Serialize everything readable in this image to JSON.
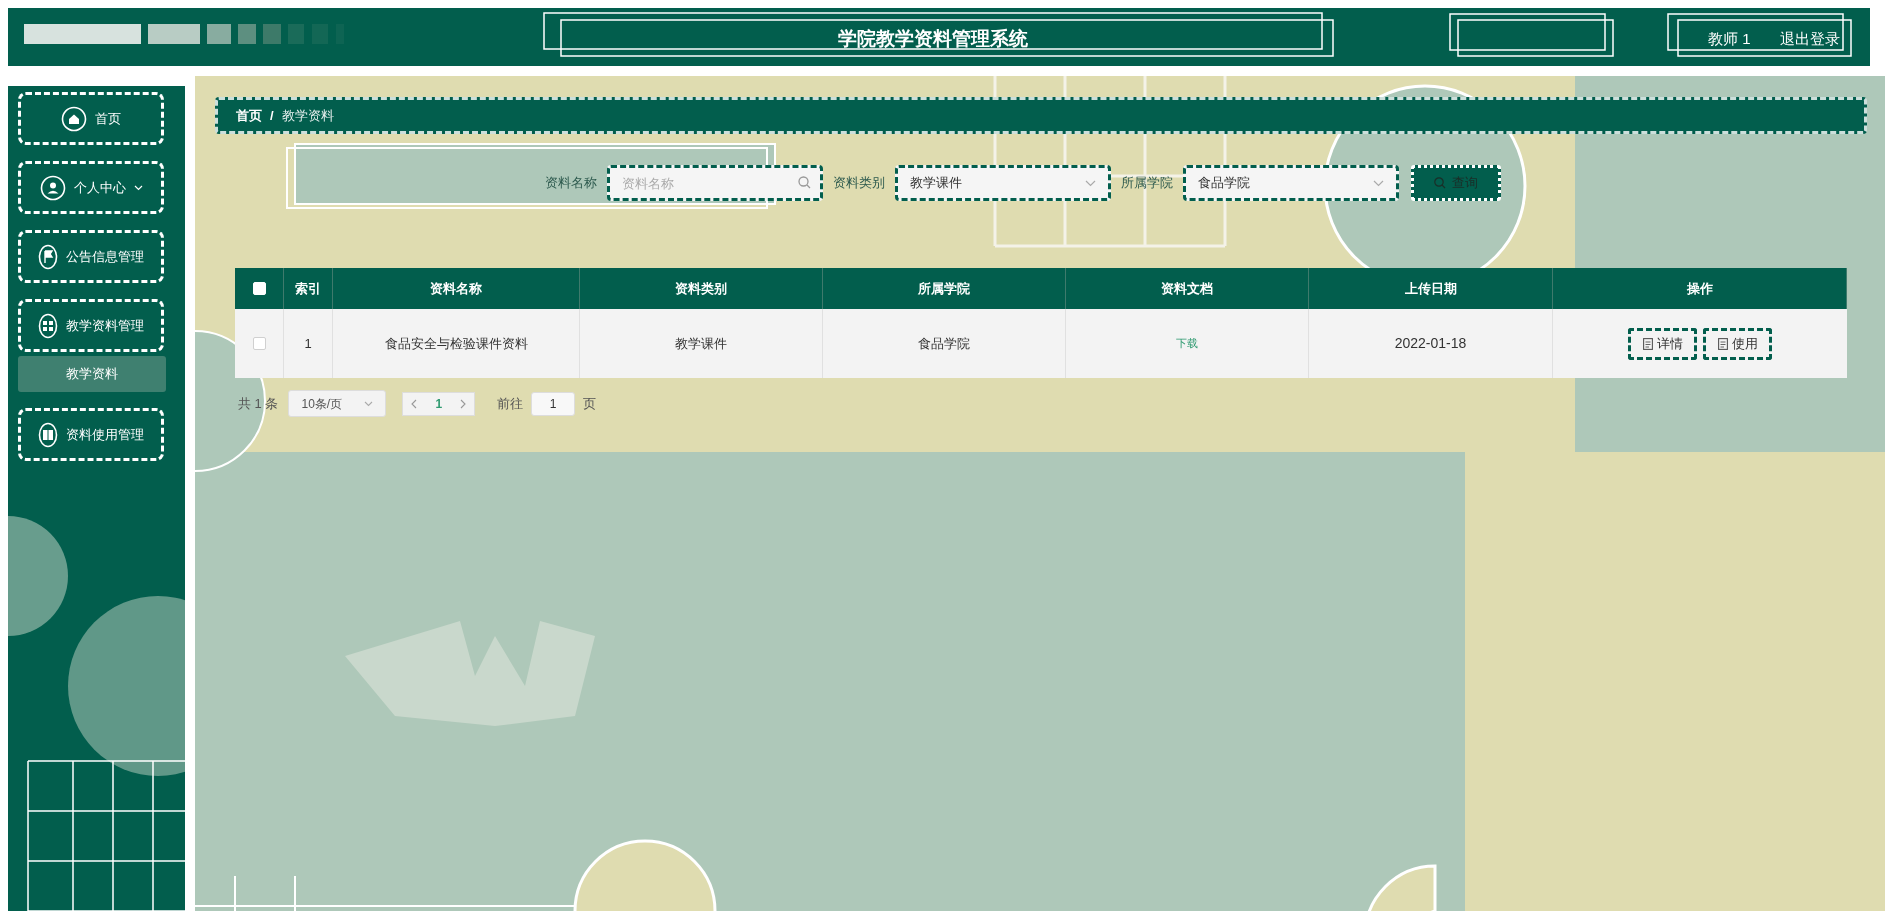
{
  "header": {
    "title": "学院教学资料管理系统",
    "user": "教师 1",
    "logout": "退出登录"
  },
  "sidebar": {
    "items": [
      {
        "label": "首页",
        "has_caret": false
      },
      {
        "label": "个人中心",
        "has_caret": true
      },
      {
        "label": "公告信息管理",
        "has_caret": false
      },
      {
        "label": "教学资料管理",
        "has_caret": false,
        "children": [
          {
            "label": "教学资料",
            "selected": true
          }
        ]
      },
      {
        "label": "资料使用管理",
        "has_caret": false
      }
    ]
  },
  "breadcrumb": {
    "items": [
      "首页",
      "教学资料"
    ],
    "separator": "/"
  },
  "filters": [
    {
      "kind": "input",
      "label": "资料名称",
      "placeholder": "资料名称"
    },
    {
      "kind": "select",
      "label": "资料类别",
      "value": "教学课件"
    },
    {
      "kind": "select",
      "label": "所属学院",
      "value": "食品学院"
    }
  ],
  "search_button": "查询",
  "table": {
    "all_selected": false,
    "columns": [
      "索引",
      "资料名称",
      "资料类别",
      "所属学院",
      "资料文档",
      "上传日期",
      "操作"
    ],
    "rows": [
      {
        "selected": false,
        "cells": [
          "1",
          "食品安全与检验课件资料",
          "教学课件",
          "食品学院"
        ],
        "document": "下载",
        "date": "2022-01-18",
        "actions": [
          "详情",
          "使用"
        ]
      }
    ]
  },
  "pagination": {
    "total": "共 1 条",
    "page_size": "10条/页",
    "page": "1",
    "goto_label": "前往",
    "goto_value": "1",
    "page_suffix": "页"
  }
}
